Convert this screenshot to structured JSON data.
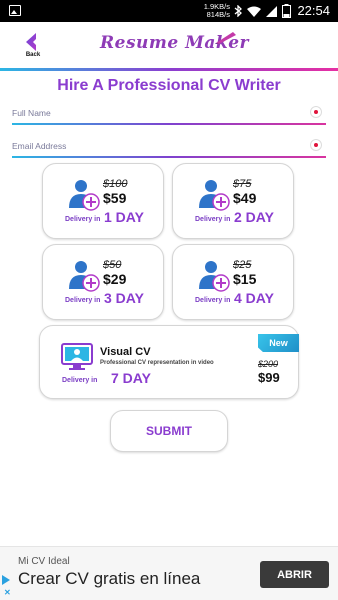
{
  "status_bar": {
    "speed_up": "1.9KB/s",
    "speed_down": "814B/s",
    "battery": "25",
    "time": "22:54"
  },
  "header": {
    "back_label": "Back",
    "app_title": "Resume Maker"
  },
  "page": {
    "title": "Hire A Professional CV Writer"
  },
  "form": {
    "full_name_placeholder": "Full Name",
    "email_placeholder": "Email Address"
  },
  "plans": [
    {
      "old_price": "$100",
      "new_price": "$59",
      "delivery_label": "Delivery in",
      "delivery_days": "1 DAY"
    },
    {
      "old_price": "$75",
      "new_price": "$49",
      "delivery_label": "Delivery in",
      "delivery_days": "2 DAY"
    },
    {
      "old_price": "$50",
      "new_price": "$29",
      "delivery_label": "Delivery in",
      "delivery_days": "3 DAY"
    },
    {
      "old_price": "$25",
      "new_price": "$15",
      "delivery_label": "Delivery in",
      "delivery_days": "4 DAY"
    }
  ],
  "visual_cv": {
    "badge": "New",
    "title": "Visual CV",
    "subtitle": "Professional CV representation in video",
    "delivery_label": "Delivery in",
    "delivery_days": "7 DAY",
    "old_price": "$200",
    "new_price": "$99"
  },
  "submit_label": "SUBMIT",
  "ad": {
    "advertiser": "Mi CV Ideal",
    "headline": "Crear CV gratis en línea",
    "button": "ABRIR"
  },
  "colors": {
    "accent_purple": "#8a3ccf",
    "accent_cyan": "#2cb6e4",
    "accent_pink": "#e62fa3",
    "required_red": "#e0143c"
  }
}
